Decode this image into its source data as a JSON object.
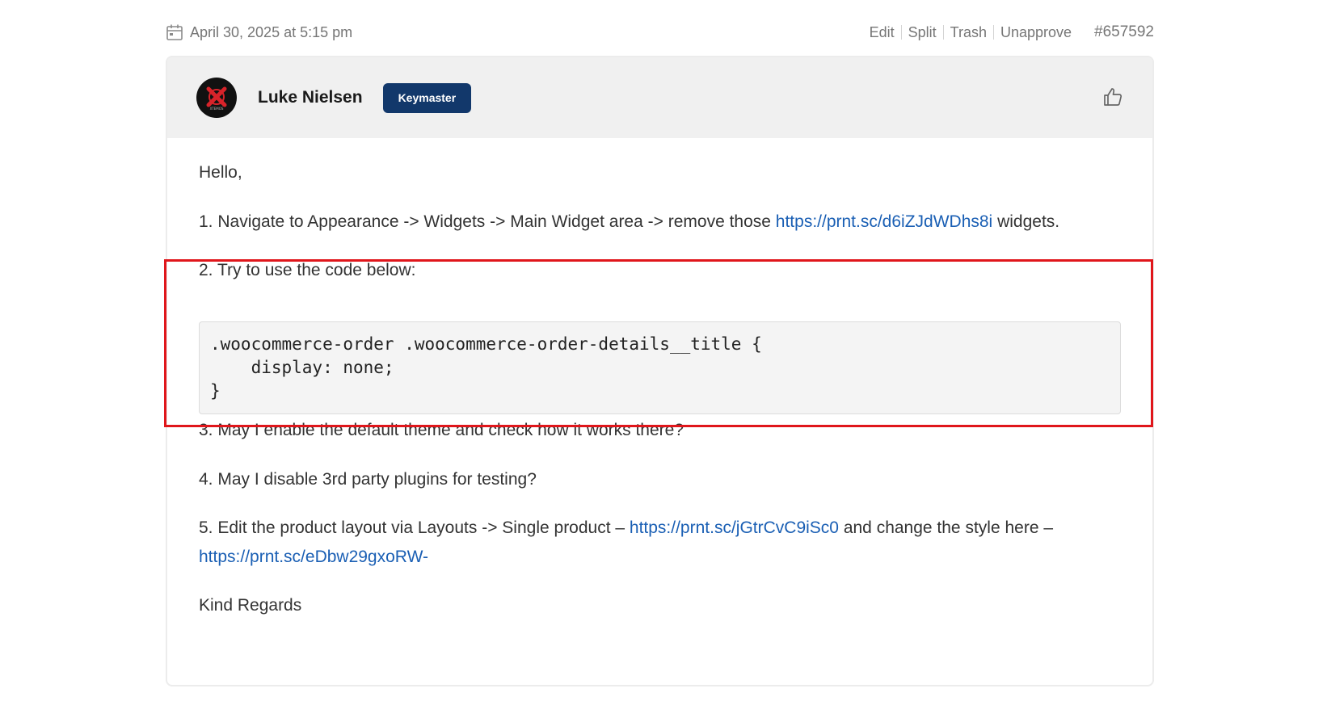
{
  "meta": {
    "date": "April 30, 2025 at 5:15 pm",
    "actions": [
      "Edit",
      "Split",
      "Trash",
      "Unapprove"
    ],
    "post_id": "#657592"
  },
  "author": {
    "name": "Luke Nielsen",
    "role": "Keymaster",
    "avatar_text": "XTEMOS"
  },
  "body": {
    "greeting": "Hello,",
    "item1_text": "1. Navigate to Appearance -> Widgets -> Main Widget area -> remove those ",
    "item1_link": "https://prnt.sc/d6iZJdWDhs8i",
    "item1_tail": " widgets.",
    "item2_text": "2. Try to use the code below:",
    "code": ".woocommerce-order .woocommerce-order-details__title {\n    display: none;\n}",
    "item3_text": "3. May I enable the default theme and check how it works there?",
    "item4_text": "4. May I disable 3rd party plugins for testing?",
    "item5_text": "5. Edit the product layout via Layouts -> Single product – ",
    "item5_link1": "https://prnt.sc/jGtrCvC9iSc0",
    "item5_mid": " and change the style here –",
    "item5_link2": "https://prnt.sc/eDbw29gxoRW-",
    "signoff": "Kind Regards"
  },
  "colors": {
    "link": "#1a5fb4",
    "badge": "#12386b",
    "highlight": "#e0161b"
  }
}
